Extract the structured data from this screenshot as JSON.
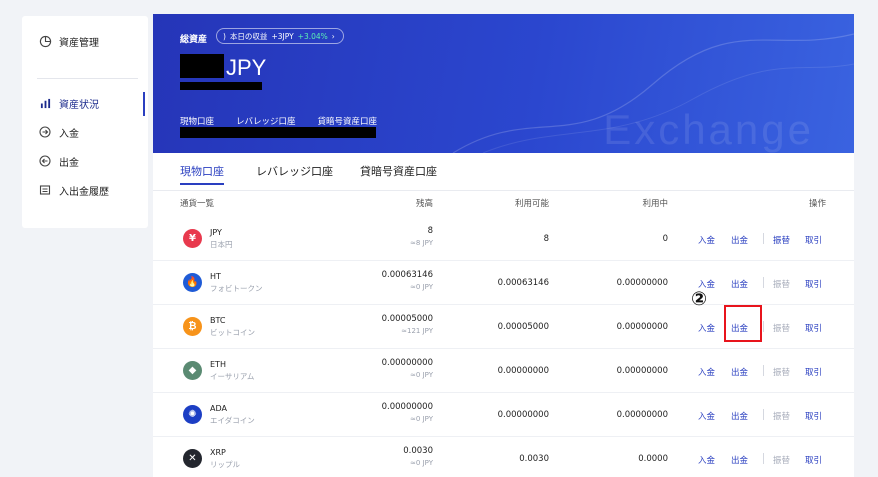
{
  "sidebar": {
    "items": [
      {
        "label": "資産管理",
        "icon": "pie-chart-icon"
      },
      {
        "label": "資産状況",
        "icon": "bar-chart-icon"
      },
      {
        "label": "入金",
        "icon": "deposit-icon"
      },
      {
        "label": "出金",
        "icon": "withdraw-icon"
      },
      {
        "label": "入出金履歴",
        "icon": "history-icon"
      }
    ]
  },
  "hero": {
    "total_label": "総資産",
    "today_label": "本日の収益",
    "today_value": "+3JPY",
    "today_pct": "+3.04%",
    "currency": "JPY",
    "accounts": [
      "現物口座",
      "レバレッジ口座",
      "貸暗号資産口座"
    ],
    "watermark": "Exchange"
  },
  "tabs": [
    "現物口座",
    "レバレッジ口座",
    "貸暗号資産口座"
  ],
  "table": {
    "headers": [
      "通貨一覧",
      "残高",
      "利用可能",
      "利用中",
      "操作"
    ],
    "actions": {
      "deposit": "入金",
      "withdraw": "出金",
      "transfer": "振替",
      "trade": "取引"
    },
    "rows": [
      {
        "symbol": "JPY",
        "name": "日本円",
        "balance": "8",
        "approx": "≈8 JPY",
        "available": "8",
        "in_use": "0",
        "icon_color": "#e8394d",
        "icon_char": "¥",
        "transfer_enabled": true
      },
      {
        "symbol": "HT",
        "name": "フォビトークン",
        "balance": "0.00063146",
        "approx": "≈0 JPY",
        "available": "0.00063146",
        "in_use": "0.00000000",
        "icon_color": "#1f5bd6",
        "icon_char": "🔥",
        "transfer_enabled": false
      },
      {
        "symbol": "BTC",
        "name": "ビットコイン",
        "balance": "0.00005000",
        "approx": "≈121 JPY",
        "available": "0.00005000",
        "in_use": "0.00000000",
        "icon_color": "#f7931a",
        "icon_char": "₿",
        "transfer_enabled": false
      },
      {
        "symbol": "ETH",
        "name": "イーサリアム",
        "balance": "0.00000000",
        "approx": "≈0 JPY",
        "available": "0.00000000",
        "in_use": "0.00000000",
        "icon_color": "#5a8a72",
        "icon_char": "◆",
        "transfer_enabled": false
      },
      {
        "symbol": "ADA",
        "name": "エイダコイン",
        "balance": "0.00000000",
        "approx": "≈0 JPY",
        "available": "0.00000000",
        "in_use": "0.00000000",
        "icon_color": "#1c3ec4",
        "icon_char": "✺",
        "transfer_enabled": false
      },
      {
        "symbol": "XRP",
        "name": "リップル",
        "balance": "0.0030",
        "approx": "≈0 JPY",
        "available": "0.0030",
        "in_use": "0.0000",
        "icon_color": "#23262e",
        "icon_char": "✕",
        "transfer_enabled": false
      }
    ]
  },
  "annotation": {
    "marker": "②"
  }
}
